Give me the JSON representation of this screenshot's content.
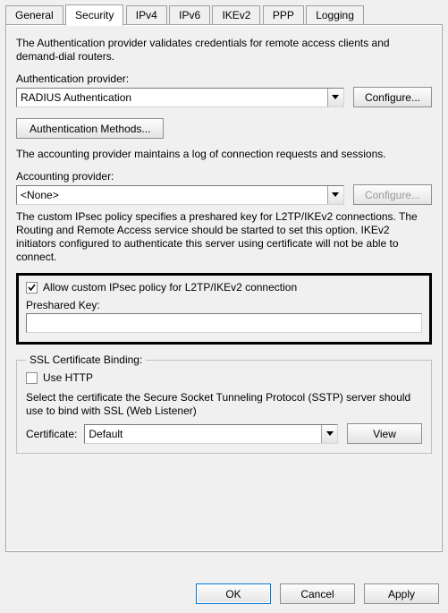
{
  "tabs": {
    "general": "General",
    "security": "Security",
    "ipv4": "IPv4",
    "ipv6": "IPv6",
    "ikev2": "IKEv2",
    "ppp": "PPP",
    "logging": "Logging"
  },
  "security": {
    "auth_desc": "The Authentication provider validates credentials for remote access clients and demand-dial routers.",
    "auth_provider_label": "Authentication provider:",
    "auth_provider_value": "RADIUS Authentication",
    "configure_label": "Configure...",
    "auth_methods_label": "Authentication Methods...",
    "acct_desc": "The accounting provider maintains a log of connection requests and sessions.",
    "acct_provider_label": "Accounting provider:",
    "acct_provider_value": "<None>",
    "ipsec_desc": "The custom IPsec policy specifies a preshared key for L2TP/IKEv2 connections. The Routing and Remote Access service should be started to set this option. IKEv2 initiators configured to authenticate this server using certificate will not be able to connect.",
    "allow_custom_ipsec_label": "Allow custom IPsec policy for L2TP/IKEv2 connection",
    "allow_custom_ipsec_checked": true,
    "preshared_key_label": "Preshared Key:",
    "preshared_key_value": "",
    "ssl_group_label": "SSL Certificate Binding:",
    "use_http_label": "Use HTTP",
    "use_http_checked": false,
    "ssl_desc": "Select the certificate the Secure Socket Tunneling Protocol (SSTP) server should use to bind with SSL (Web Listener)",
    "cert_label": "Certificate:",
    "cert_value": "Default",
    "view_label": "View"
  },
  "buttons": {
    "ok": "OK",
    "cancel": "Cancel",
    "apply": "Apply"
  }
}
